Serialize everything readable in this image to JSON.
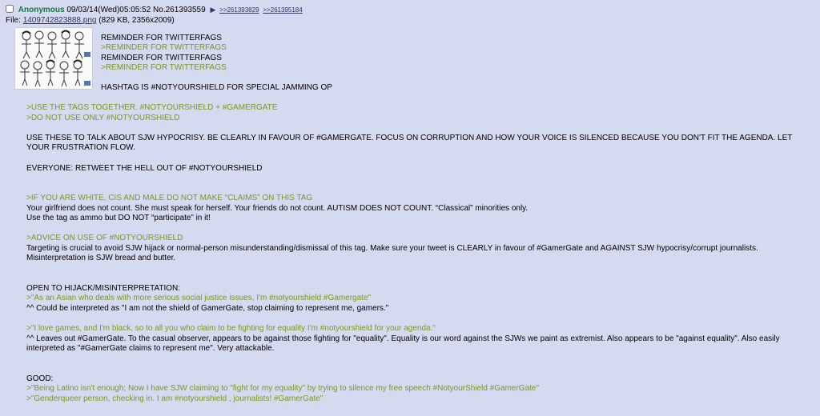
{
  "header": {
    "name": "Anonymous",
    "datetime": "09/03/14(Wed)05:05:52",
    "post_no": "No.261393559",
    "arrow": "▶",
    "backlinks": [
      ">>261393829",
      ">>261395184"
    ]
  },
  "file": {
    "label": "File:",
    "filename": "1409742823888.png",
    "meta": "(829 KB, 2356x2009)"
  },
  "thumbnail": {
    "icon": "people-comic-thumbnail-icon"
  },
  "colors": {
    "post_bg": "#d6daf0",
    "name": "#117743",
    "greentext": "#789922",
    "link": "#34345c"
  },
  "lines": [
    {
      "text": "REMINDER FOR TWITTERFAGS",
      "quote": false
    },
    {
      "text": ">REMINDER FOR TWITTERFAGS",
      "quote": true
    },
    {
      "text": "REMINDER FOR TWITTERFAGS",
      "quote": false
    },
    {
      "text": ">REMINDER FOR TWITTERFAGS",
      "quote": true
    },
    {
      "text": "HASHTAG IS #NOTYOURSHIELD FOR SPECIAL JAMMING OP",
      "quote": false
    },
    {
      "text": ">USE THE TAGS TOGETHER. #NOTYOURSHIELD + #GAMERGATE",
      "quote": true
    },
    {
      "text": ">DO NOT USE ONLY #NOTYOURSHIELD",
      "quote": true
    },
    {
      "text": "USE THESE TO TALK ABOUT SJW HYPOCRISY. BE CLEARLY IN FAVOUR OF #GAMERGATE. FOCUS ON CORRUPTION AND HOW YOUR VOICE IS SILENCED BECAUSE YOU DON'T FIT THE AGENDA. LET YOUR FRUSTRATION FLOW.",
      "quote": false
    },
    {
      "text": "EVERYONE: RETWEET THE HELL OUT OF #NOTYOURSHIELD",
      "quote": false
    },
    {
      "text": ">IF YOU ARE WHITE, CIS AND MALE DO NOT MAKE “CLAIMS” ON THIS TAG",
      "quote": true
    },
    {
      "text": "Your girlfriend does not count. She must speak for herself. Your friends do not count. AUTISM DOES NOT COUNT. “Classical” minorities only.",
      "quote": false
    },
    {
      "text": "Use the tag as ammo but DO NOT “participate” in it!",
      "quote": false
    },
    {
      "text": ">ADVICE ON USE OF #NOTYOURSHIELD",
      "quote": true
    },
    {
      "text": "Targeting is crucial to avoid SJW hijack or normal-person misunderstanding/dismissal of this tag. Make sure your tweet is CLEARLY in favour of #GamerGate and AGAINST SJW hypocrisy/corrupt journalists.",
      "quote": false
    },
    {
      "text": "Misinterpretation is SJW bread and butter.",
      "quote": false
    },
    {
      "text": "OPEN TO HIJACK/MISINTERPRETATION:",
      "quote": false
    },
    {
      "text": ">\"As an Asian who deals with more serious social justice issues, I'm #notyourshield #Gamergate\"",
      "quote": true
    },
    {
      "text": "^^ Could be interpreted as \"I am not the shield of GamerGate, stop claiming to represent me, gamers.\"",
      "quote": false
    },
    {
      "text": ">\"I love games, and I'm black, so to all you who claim to be fighting for equality I'm #notyourshield for your agenda.\"",
      "quote": true
    },
    {
      "text": "^^ Leaves out #GamerGate. To the casual observer, appears to be against those fighting for \"equality\". Equality is our word against the SJWs we paint as extremist. Also appears to be \"against equality\". Also easily interpreted as \"#GamerGate claims to represent me\". Very attackable.",
      "quote": false
    },
    {
      "text": "GOOD:",
      "quote": false
    },
    {
      "text": ">\"Being Latino isn't enough; Now I have SJW claiming to \"fight for my equality\" by trying to silence my free speech #NotyourShield #GamerGate\"",
      "quote": true
    },
    {
      "text": ">\"Genderqueer person, checking in. I am #notyourshield , journalists! #GamerGate\"",
      "quote": true
    }
  ]
}
